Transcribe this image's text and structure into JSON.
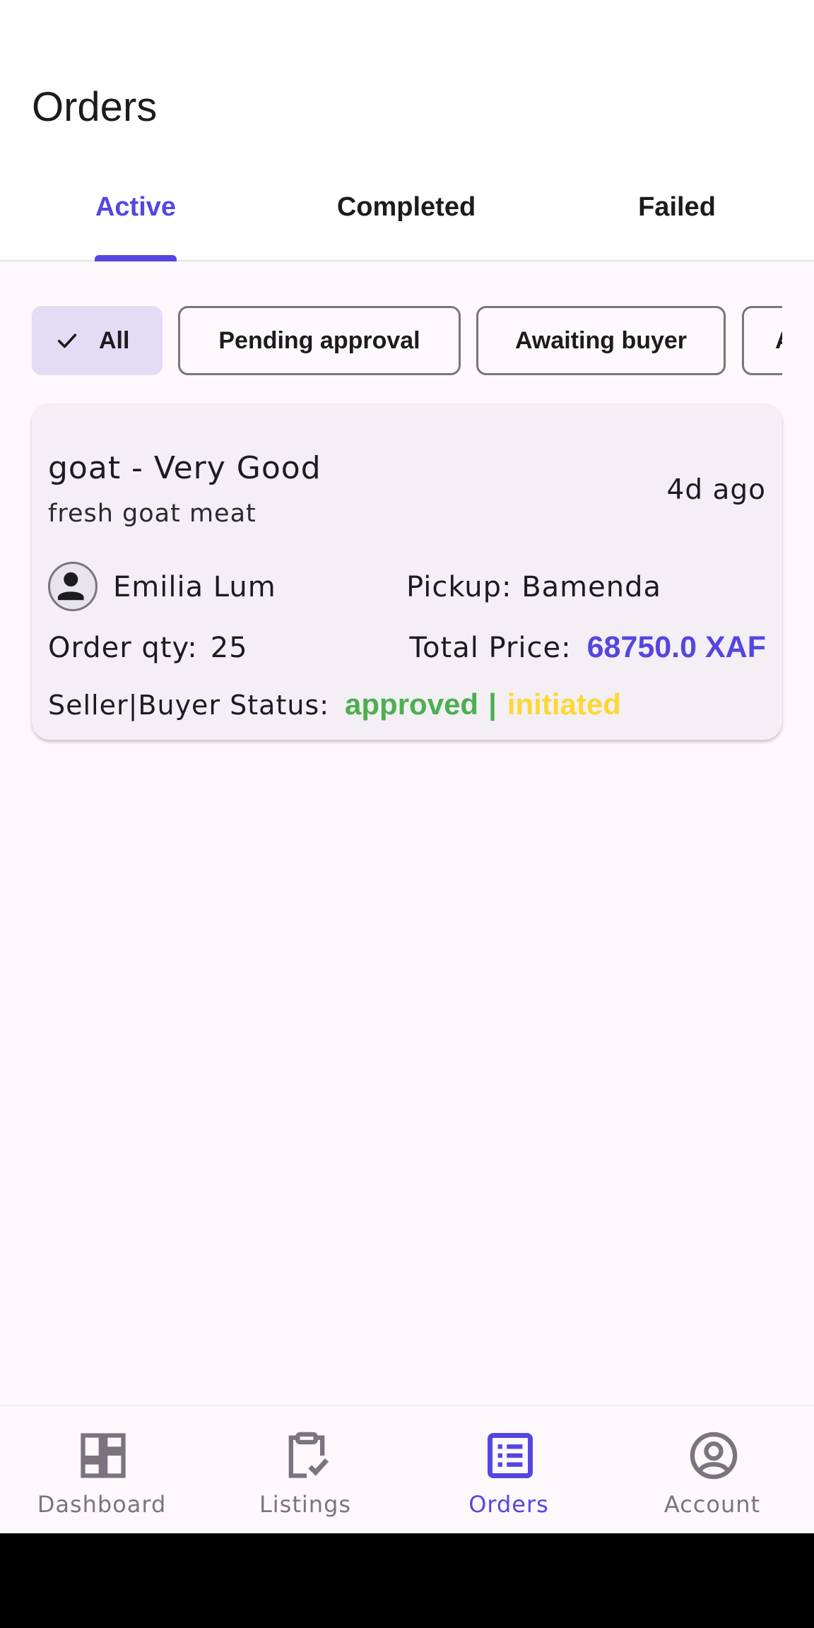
{
  "header": {
    "title": "Orders"
  },
  "tabs": [
    {
      "label": "Active",
      "active": true
    },
    {
      "label": "Completed",
      "active": false
    },
    {
      "label": "Failed",
      "active": false
    }
  ],
  "filters": [
    {
      "label": "All",
      "selected": true,
      "icon": "check-icon"
    },
    {
      "label": "Pending approval",
      "selected": false
    },
    {
      "label": "Awaiting buyer",
      "selected": false
    },
    {
      "label": "A",
      "selected": false
    }
  ],
  "orders": [
    {
      "title": "goat - Very Good",
      "description": "fresh goat meat",
      "time_ago": "4d ago",
      "buyer_icon": "person-icon",
      "buyer_name": "Emilia Lum",
      "pickup_label": "Pickup: Bamenda",
      "qty_label": "Order qty:",
      "qty_value": "25",
      "price_label": "Total Price:",
      "price_value": "68750.0 XAF",
      "status_label": "Seller|Buyer Status:",
      "seller_status": "approved",
      "status_separator": "|",
      "buyer_status": "initiated"
    }
  ],
  "bottom_nav": [
    {
      "label": "Dashboard",
      "icon": "dashboard-icon",
      "active": false
    },
    {
      "label": "Listings",
      "icon": "clipboard-check-icon",
      "active": false
    },
    {
      "label": "Orders",
      "icon": "list-icon",
      "active": true
    },
    {
      "label": "Account",
      "icon": "account-circle-icon",
      "active": false
    }
  ],
  "colors": {
    "accent": "#5546e0",
    "seller_status": "#4caf50",
    "buyer_status": "#fdd835",
    "chip_selected_bg": "#e3dcf5",
    "card_bg": "#f3eff5",
    "page_bg": "#fdf8fc"
  }
}
